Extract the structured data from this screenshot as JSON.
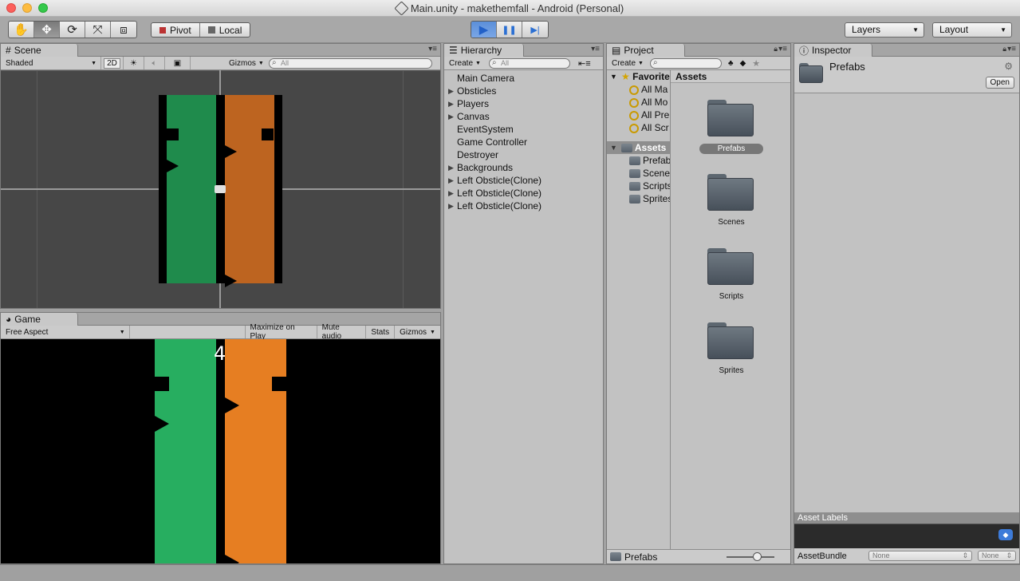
{
  "window": {
    "title": "Main.unity - makethemfall - Android (Personal)"
  },
  "toolbar": {
    "tools": [
      {
        "icon": "hand-icon",
        "glyph": "✋"
      },
      {
        "icon": "move-icon",
        "glyph": "✥"
      },
      {
        "icon": "rotate-icon",
        "glyph": "⟳"
      },
      {
        "icon": "scale-icon",
        "glyph": "⤧"
      },
      {
        "icon": "rect-icon",
        "glyph": "⧈"
      }
    ],
    "pivot_label": "Pivot",
    "local_label": "Local",
    "play_glyph": "▶",
    "pause_glyph": "❚❚",
    "step_glyph": "▶|",
    "layers_label": "Layers",
    "layout_label": "Layout"
  },
  "scene": {
    "tab_label": "Scene",
    "shading": "Shaded",
    "mode_2d": "2D",
    "gizmos": "Gizmos",
    "search_placeholder": "All"
  },
  "game": {
    "tab_label": "Game",
    "aspect": "Free Aspect",
    "maximize": "Maximize on Play",
    "mute": "Mute audio",
    "stats": "Stats",
    "gizmos": "Gizmos",
    "score": "4"
  },
  "colors": {
    "green_scene": "#1f8b4c",
    "orange_scene": "#bd6420",
    "green_game": "#27ae60",
    "orange_game": "#e67e22"
  },
  "hierarchy": {
    "tab_label": "Hierarchy",
    "create": "Create",
    "search_placeholder": "All",
    "items": [
      {
        "label": "Main Camera",
        "expandable": false
      },
      {
        "label": "Obsticles",
        "expandable": true
      },
      {
        "label": "Players",
        "expandable": true
      },
      {
        "label": "Canvas",
        "expandable": true
      },
      {
        "label": "EventSystem",
        "expandable": false
      },
      {
        "label": "Game Controller",
        "expandable": false
      },
      {
        "label": "Destroyer",
        "expandable": false
      },
      {
        "label": "Backgrounds",
        "expandable": true
      },
      {
        "label": "Left Obsticle(Clone)",
        "expandable": true
      },
      {
        "label": "Left Obsticle(Clone)",
        "expandable": true
      },
      {
        "label": "Left Obsticle(Clone)",
        "expandable": true
      }
    ]
  },
  "project": {
    "tab_label": "Project",
    "create": "Create",
    "favorites_label": "Favorites",
    "favorites": [
      "All Ma",
      "All Mo",
      "All Pre",
      "All Scr"
    ],
    "assets_label": "Assets",
    "asset_folders": [
      "Prefab",
      "Scenes",
      "Scripts",
      "Sprites"
    ],
    "breadcrumb": "Assets",
    "grid": [
      "Prefabs",
      "Scenes",
      "Scripts",
      "Sprites"
    ],
    "footer_path": "Prefabs"
  },
  "inspector": {
    "tab_label": "Inspector",
    "asset_name": "Prefabs",
    "open_button": "Open",
    "asset_labels": "Asset Labels",
    "asset_bundle": "AssetBundle",
    "bundle_value": "None",
    "variant_value": "None"
  }
}
